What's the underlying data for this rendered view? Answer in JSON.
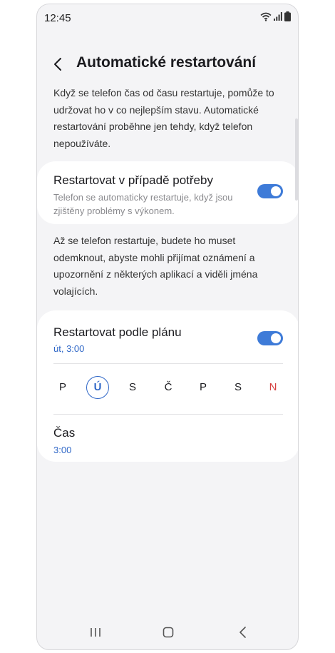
{
  "status_bar": {
    "time": "12:45",
    "icons": [
      "wifi-icon",
      "signal-icon",
      "battery-icon"
    ]
  },
  "header": {
    "back_icon": "chevron-left-icon",
    "title": "Automatické restartování"
  },
  "intro_text": "Když se telefon čas od času restartuje, pomůže to udržovat ho v co nejlepším stavu. Automatické restartování proběhne jen tehdy, když telefon nepoužíváte.",
  "restart_when_needed": {
    "title": "Restartovat v případě potřeby",
    "description": "Telefon se automaticky restartuje, když jsou zjištěny problémy s výkonem.",
    "enabled": true
  },
  "note_text": "Až se telefon restartuje, budete ho muset odemknout, abyste mohli přijímat oznámení a upozornění z některých aplikací a viděli jména volajících.",
  "scheduled_restart": {
    "title": "Restartovat podle plánu",
    "summary": "út, 3:00",
    "enabled": true,
    "days": [
      {
        "label": "P",
        "selected": false
      },
      {
        "label": "Ú",
        "selected": true
      },
      {
        "label": "S",
        "selected": false
      },
      {
        "label": "Č",
        "selected": false
      },
      {
        "label": "P",
        "selected": false
      },
      {
        "label": "S",
        "selected": false
      },
      {
        "label": "N",
        "selected": false,
        "sunday": true
      }
    ],
    "time_label": "Čas",
    "time_value": "3:00"
  },
  "nav_bar": {
    "icons": [
      "recent-apps-icon",
      "home-icon",
      "back-icon"
    ]
  },
  "colors": {
    "accent": "#3e7bd8",
    "accent_text": "#2f67c7",
    "sunday": "#d64040",
    "background": "#f4f4f6",
    "card": "#ffffff"
  }
}
